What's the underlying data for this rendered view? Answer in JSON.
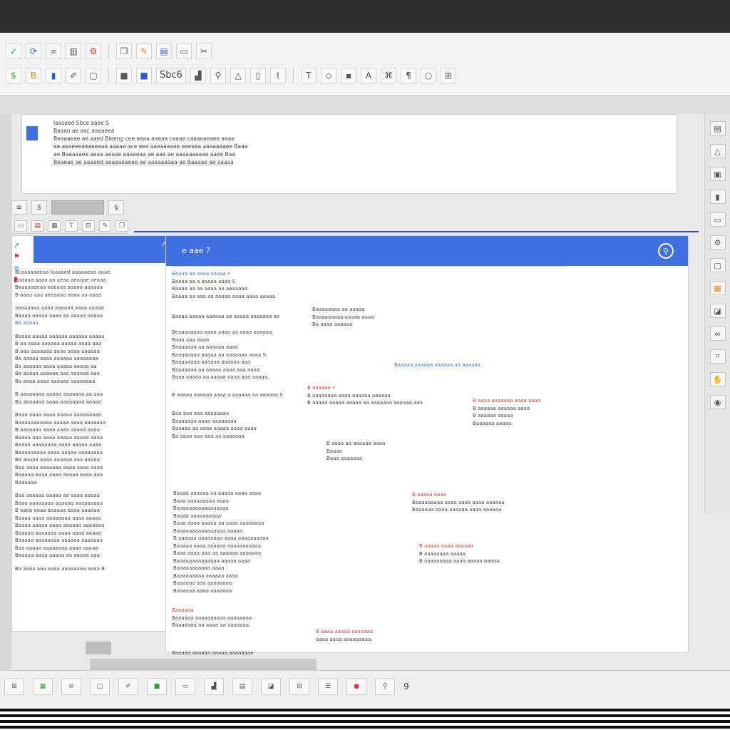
{
  "toolbar": {
    "row1": [
      {
        "icon": "checkmark-icon",
        "glyph": "✓",
        "color": "green"
      },
      {
        "icon": "refresh-icon",
        "glyph": "⟳",
        "color": "blue"
      },
      {
        "icon": "link-icon",
        "glyph": "∞",
        "color": ""
      },
      {
        "icon": "bar-icon",
        "glyph": "▥",
        "color": ""
      },
      {
        "icon": "settings-icon",
        "glyph": "⚙",
        "color": "red"
      },
      {
        "icon": "copy-icon",
        "glyph": "❐",
        "color": ""
      },
      {
        "icon": "brush-icon",
        "glyph": "✎",
        "color": "orange"
      },
      {
        "icon": "folder-icon",
        "glyph": "▤",
        "color": "blue"
      },
      {
        "icon": "window-icon",
        "glyph": "▭",
        "color": ""
      },
      {
        "icon": "cut-icon",
        "glyph": "✂",
        "color": ""
      }
    ],
    "row2": [
      {
        "icon": "money-icon",
        "glyph": "$",
        "color": "green"
      },
      {
        "icon": "bold-icon",
        "glyph": "B",
        "color": "orange"
      },
      {
        "icon": "mark-icon",
        "glyph": "▮",
        "color": "blue"
      },
      {
        "icon": "pen-icon",
        "glyph": "✐",
        "color": ""
      },
      {
        "icon": "frame-icon",
        "glyph": "▢",
        "color": ""
      },
      {
        "icon": "fill-icon",
        "glyph": "■",
        "color": ""
      },
      {
        "icon": "blue-fill-icon",
        "glyph": "■",
        "color": "blue"
      },
      {
        "icon": "chart-icon",
        "glyph": "▟",
        "color": ""
      },
      {
        "icon": "search-icon",
        "glyph": "⚲",
        "color": ""
      },
      {
        "icon": "triangle-icon",
        "glyph": "△",
        "color": ""
      },
      {
        "icon": "ruler-icon",
        "glyph": "▯",
        "color": ""
      },
      {
        "icon": "align-icon",
        "glyph": "Ⅰ",
        "color": ""
      },
      {
        "icon": "text-icon",
        "glyph": "T",
        "color": ""
      },
      {
        "icon": "shape-icon",
        "glyph": "◇",
        "color": ""
      },
      {
        "icon": "cell-icon",
        "glyph": "▪",
        "color": ""
      },
      {
        "icon": "letter-icon",
        "glyph": "A",
        "color": ""
      },
      {
        "icon": "plug-icon",
        "glyph": "⌘",
        "color": ""
      },
      {
        "icon": "paragraph-icon",
        "glyph": "¶",
        "color": ""
      },
      {
        "icon": "circle-icon",
        "glyph": "○",
        "color": ""
      },
      {
        "icon": "grid-icon",
        "glyph": "⊞",
        "color": ""
      }
    ],
    "text_field": "Sbc6"
  },
  "top_panel": {
    "lines": [
      "Iaasaed Sbce aaee S",
      "Baaao ae aac aaaaeea",
      "Beaaaeae ae aaed Bieeng cee.aeaa aaeaa caaae caaaeaeaee aeae",
      "ae aeaeeeaeaeeaae aaaae ace eea aaeaaaaee eeeaea aaaaaaaee Baaa",
      "ae Baaaaaee aeaa aeaae aaaaeaa ae aae ae aaaaaaaaae aaee Baa",
      "Beaeae ae aaaaed aeaeaeaeae ae aaaaaaaaa ae Baaaae ae aaaaa"
    ]
  },
  "left_doc": {
    "lines": [
      "Bcaaaaaeeaa Iaaaaed aaaaaeaa aaae",
      "Baaaaa aaaa aa aeaa aeaaae aeaaa",
      "Baaaaaaeaa aaeaaa aaaaa aaaaaa",
      "B aaaa aaa aaeaaaa aaaa aa aaaa",
      "",
      "aaaaaaaa aaaa aaaaaa aaaa aaaaa",
      "Baaaa aaaaa aaaa aa aaaaa aaaaa",
      "Ba aaaaa",
      "",
      "Baaaa aaaaa aaaaaa aaaaaa aaaaa",
      "B aa aaaa aaaaaa aaaaa aaaa aaa",
      "B aaa aaaaaaa aaaa aaaa aaaaaa",
      "Ba aaaaa aaaa aaaaaa aaaaaaaa",
      "Ba aaaaaa aaaa aaaaa aaaaa aa",
      "Ba aaaaa aaaaaa aaa aaaaaa aaa",
      "Ba aaaa aaaa aaaaaa aaaaaaaa",
      "",
      "B aaaaaaaa aaaaa aaaaaaa aa aaa",
      "Ba aaaaaaa aaaa aaaaaaaa aaaaa",
      "",
      "Baaa aaaa aaaa aaaaa aaaaaaaaa",
      "Baaaaaaaaaaa aaaaa aaaa aaaaaaa",
      "B aaaaaaa aaaa aaaa aaaaa aaaa",
      "Baaaa aaa aaaa aaaaa aaaaa aaaa",
      "Baaaa aaaaaaaa aaaa aaaaa aaaa",
      "Baaaaaaaaa aaaa aaaaa aaaaaaaa",
      "Ba aaaaa aaaa aaaaaa aaa aaaaa",
      "Baa aaaa aaaaaaa aaaa aaaa aaaa",
      "Baaaaa aaaa aaaa aaaaa aaaa aaa",
      "Baaaaaa",
      "",
      "Baa aaaaaa aaaaa aa aaaa aaaaa",
      "Baaa aaaaaaaa aaaaaa aaaaaaaaa",
      "B aaaa aaaa aaaaaa aaaa aaaaaa",
      "Baaaa aaaa aaaaaaaa aaaa aaaaa",
      "Baaaa aaaaa aaaa aaaaaa aaaaaaa",
      "Baaaaa aaaaaaa aaaa aaaa aaaaa",
      "Baaaaa aaaaaaaa aaaaaa aaaaaaa",
      "Baa aaaaa aaaaaaaa aaaa aaaaa",
      "Baaaaa aaaa aaaaa aa aaaaa aaa",
      "",
      "Ba aaaa aaa aaaa aaaaaaaa aaaa B"
    ]
  },
  "main_doc": {
    "header_title": "e aae ?",
    "blocks": [
      {
        "lines": [
          "Baaaa aa aaaa aaaaa •",
          "Baaaa aa a aaaaa aaaa S",
          "Baaaa aa aa aaaa aa aaaaaaa",
          "Baaaa aa aaa aa aaaaa aaaa aaaa aaaaa."
        ],
        "color": "blue"
      },
      {
        "lines": [
          "Baaaa aaaaa aaaaaa aa aaaaa aaaaaaa ae"
        ],
        "color": ""
      },
      {
        "lines": [
          "Baaaaaaaa aa aaaaa",
          "Baaaaaaaaa aaaaa aaaa",
          "Ba aaaa aaaaaa"
        ],
        "color": ""
      },
      {
        "lines": [
          "Beaaaaaaaa aaaa aaaa aa aaaa aaaaaa",
          "Baaa aaa aaaa",
          "Baaaaaaa aa aaaaaa aaaa",
          "Baaaaaaaa aaaaa aa aaaaaaa aaaa S",
          "Baaaaaaaa aaaaaa aaaaaa aaa",
          "Baaaaaaa aa aaaaa aaaa aaa aaaa",
          "Baaa aaaaa aa aaaaa aaaa aaa aaaaa."
        ],
        "color": ""
      },
      {
        "lines": [
          "Baaaaa aaaaaa aaaaaa aa aaaaaa."
        ],
        "color": "blue"
      },
      {
        "lines": [
          "B aaaaa aaaaaa aaaa a aaaaaa aa aaaaaa S"
        ],
        "color": ""
      },
      {
        "lines": [
          "B aaaaaa •",
          "B aaaaaaaa aaaa aaaaaa aaaaaa",
          "B aaaaa aaaaa aaaaa aa aaaaaaa aaaaaa aaa"
        ],
        "color": "red"
      },
      {
        "lines": [
          "B aaaa aaaaaaa aaaa aaaa",
          "B aaaaaa aaaaaa aaaa",
          "B aaaaaa aaaaa",
          "Baaaaaa aaaaa"
        ],
        "color": "red"
      },
      {
        "lines": [
          "Baa aaa aaa aaaaaaaa",
          "Baaaaaaa aaaa aaaaaaaa",
          "Baaaaa aa aaaa aaaaa aaaa aaaa",
          "Ba aaaa aaa aaa aa aaaaaaa."
        ],
        "color": ""
      },
      {
        "lines": [
          "B aaaa aa aaaaaa aaaa",
          "Baaaa",
          "Baaa aaaaaaa"
        ],
        "color": ""
      },
      {
        "lines": [
          "Baaaaa aaaaaa aaaaa aaaaaaaa"
        ],
        "color": ""
      },
      {
        "lines": [
          "Baaaa aaaaaa aa aaaaa aaaa aaaa",
          "Baaa aaaaaaaaa aaaa",
          "Baaaaaaaaaaaaaaaaa",
          "Baaaa aaaaaaaaaa",
          "Baaa aaaa aaaaa aa aaaa aaaaaaaa",
          "Baaaaaaaaaaaaaaaa aaaaa",
          "B aaaaaa aaaaaaaa aaaa aaaaaaaaaa",
          "Baaaaa aaaa aaaaaa aaaaaaaaaaa",
          "Baaa aaaa aaa aa aaaaaa aaaaaaa",
          "Baaaaaaaaaaaaaa aaaaa aaaa",
          "Baaaaaaaaaaa aaaa",
          "Baaaaaaaaa aaaaaa aaaa",
          "Baaaaaa aaa aaaaaaaa",
          "Baaaaaa aaaa aaaaaaa"
        ],
        "color": ""
      },
      {
        "lines": [
          "B aaaaa aaaa",
          "Baaaaaaaaa aaaa aaaa aaaa aaaaaa",
          "Baaaaaa aaaa aaaaaa aaaa aaaaaa"
        ],
        "color": "red"
      },
      {
        "lines": [
          "B aaaaa aaaa aaaaaa",
          "B aaaaaaaa aaaaa",
          "B aaaaaaaaa aaaa aaaaa aaaaa"
        ],
        "color": "red"
      },
      {
        "lines": [
          "Baaaaaa",
          "Baaaaaa aaaaaaaaaa aaaaaaaa",
          "Baaaaaaa aa aaaa aa aaaaaaa"
        ],
        "color": "red"
      },
      {
        "lines": [
          "B aaaa aaaaa aaaaaaa",
          "aaaa aaaa aaaaaaaaa."
        ],
        "color": "red"
      }
    ]
  },
  "statusbar": {
    "page_counter": "9"
  }
}
